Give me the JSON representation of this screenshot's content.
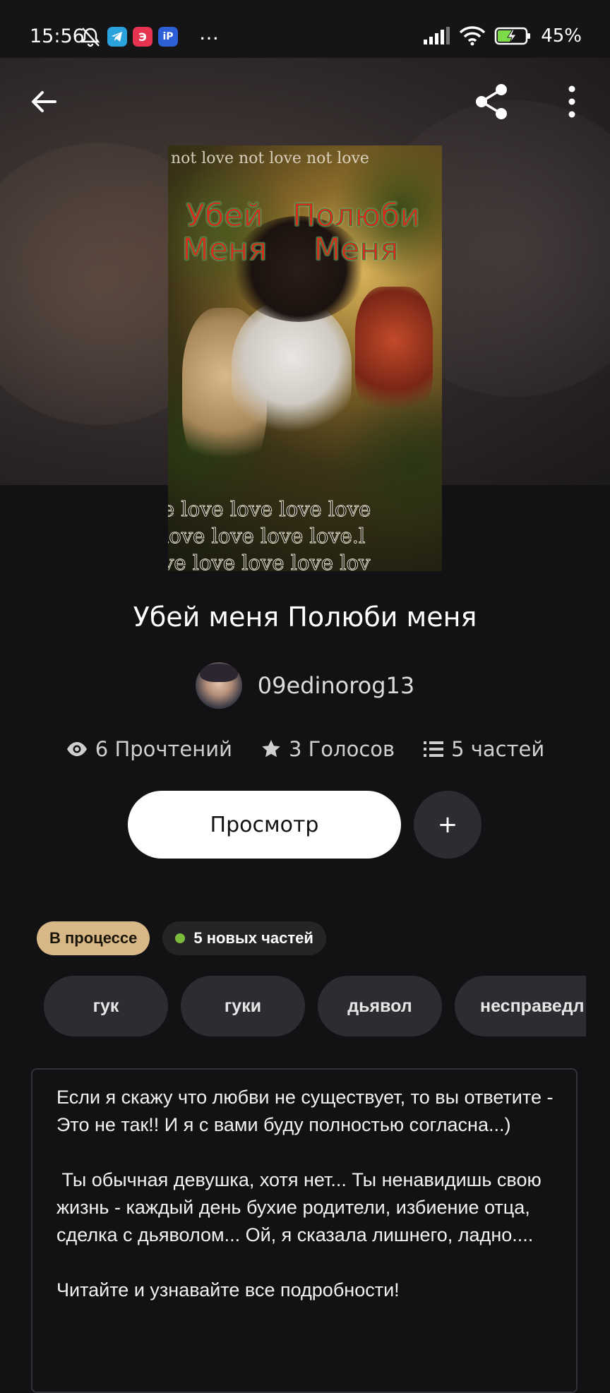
{
  "status_bar": {
    "time": "15:56",
    "battery": "45%",
    "overflow": "…"
  },
  "cover": {
    "top_text": "not love not love not love",
    "title_left": "Убей\nМеня",
    "title_right": "Полюби\nМеня",
    "bottom_text": "e love love love love\nlove love love love.l\nve love love love lov"
  },
  "story": {
    "title": "Убей меня Полюби меня",
    "author": "09edinorog13",
    "reads": "6 Прочтений",
    "votes": "3 Голосов",
    "parts": "5 частей",
    "view_button": "Просмотр",
    "add_button": "+",
    "status_badge": "В процессе",
    "new_parts_badge": "5 новых частей",
    "tags": [
      "гук",
      "гуки",
      "дьявол",
      "несправедл"
    ],
    "description": "Если я скажу что любви не существует, то вы ответите - Это не так!! И я с вами буду полностью согласна...)\n\n Ты обычная девушка, хотя нет... Ты ненавидишь свою жизнь - каждый день бухие родители, избиение отца, сделка с дьяволом... Ой, я сказала лишнего, ладно....\n\nЧитайте и узнавайте все подробности!"
  },
  "icons": {
    "back": "arrow-left-icon",
    "share": "share-icon",
    "more": "more-vertical-icon",
    "reads": "eye-icon",
    "votes": "star-icon",
    "parts": "list-icon"
  },
  "colors": {
    "background": "#121114",
    "status_badge": "#d9b887",
    "new_dot": "#7dbb3c",
    "chip": "#2d2c30"
  }
}
